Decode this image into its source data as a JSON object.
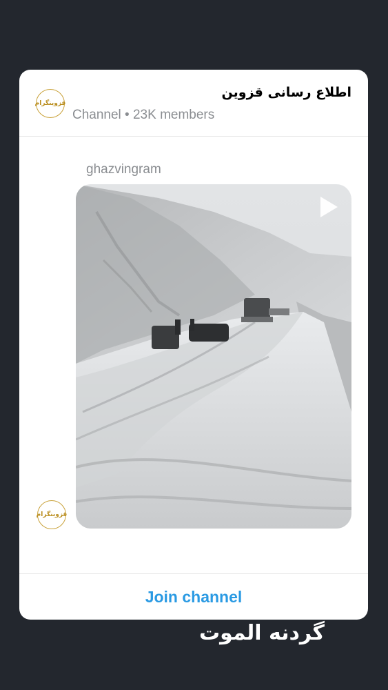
{
  "channel": {
    "title": "اطلاع رسانی قزوین",
    "subtitle": "Channel • 23K members",
    "avatar_text": "قزوینگرام",
    "avatar_icon": "channel-logo-icon"
  },
  "message": {
    "author": "ghazvingram",
    "media_type": "video",
    "play_icon": "play-icon"
  },
  "footer": {
    "join_label": "Join channel"
  },
  "caption": "گردنه الموت",
  "colors": {
    "background": "#23272e",
    "card": "#ffffff",
    "accent": "#2a9ae3",
    "muted_text": "#8a8d91",
    "logo_gold": "#c9a23a"
  }
}
